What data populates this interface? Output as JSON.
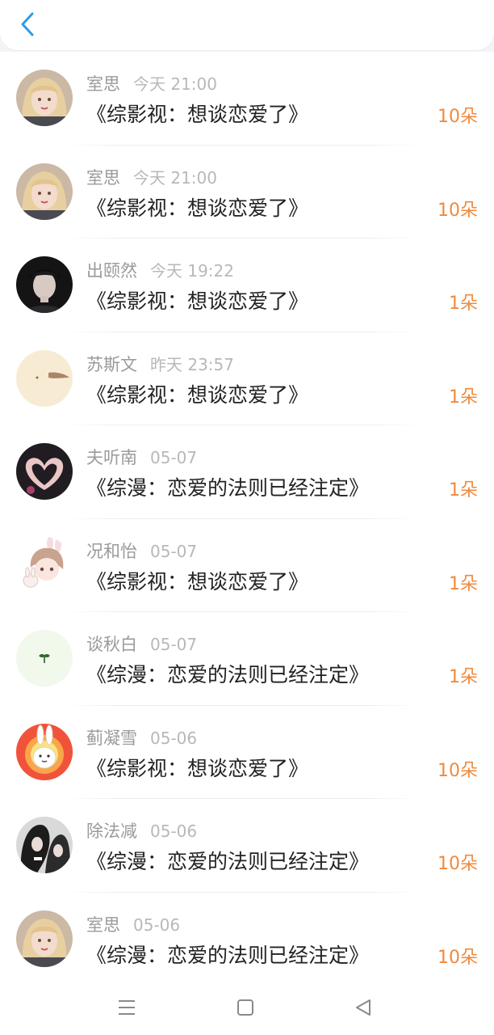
{
  "header": {
    "back_icon": "chevron-left-icon",
    "accent": "#2c9bea"
  },
  "colors": {
    "amount": "#ef8a3c",
    "name": "#9a9a9a",
    "time": "#b8b8b8",
    "title": "#222222"
  },
  "rows": [
    {
      "name": "室思",
      "time": "今天 21:00",
      "book": "《综影视：想谈恋爱了》",
      "amount": "10朵",
      "avatar": "avatar-blonde-girl"
    },
    {
      "name": "室思",
      "time": "今天 21:00",
      "book": "《综影视：想谈恋爱了》",
      "amount": "10朵",
      "avatar": "avatar-blonde-girl"
    },
    {
      "name": "出颐然",
      "time": "今天 19:22",
      "book": "《综影视：想谈恋爱了》",
      "amount": "1朵",
      "avatar": "avatar-dark-boy"
    },
    {
      "name": "苏斯文",
      "time": "昨天 23:57",
      "book": "《综影视：想谈恋爱了》",
      "amount": "1朵",
      "avatar": "avatar-beige"
    },
    {
      "name": "夫听南",
      "time": "05-07",
      "book": "《综漫：恋爱的法则已经注定》",
      "amount": "1朵",
      "avatar": "avatar-heart-hands"
    },
    {
      "name": "况和怡",
      "time": "05-07",
      "book": "《综影视：想谈恋爱了》",
      "amount": "1朵",
      "avatar": "avatar-anime-girl-bunny"
    },
    {
      "name": "谈秋白",
      "time": "05-07",
      "book": "《综漫：恋爱的法则已经注定》",
      "amount": "1朵",
      "avatar": "avatar-sprout"
    },
    {
      "name": "蓟凝雪",
      "time": "05-06",
      "book": "《综影视：想谈恋爱了》",
      "amount": "10朵",
      "avatar": "avatar-bunny-sun"
    },
    {
      "name": "除法减",
      "time": "05-06",
      "book": "《综漫：恋爱的法则已经注定》",
      "amount": "10朵",
      "avatar": "avatar-dark-anime"
    },
    {
      "name": "室思",
      "time": "05-06",
      "book": "《综漫：恋爱的法则已经注定》",
      "amount": "10朵",
      "avatar": "avatar-blonde-girl"
    }
  ],
  "navbar": {
    "menu_icon": "menu-icon",
    "home_icon": "square-home-icon",
    "back_icon": "triangle-back-icon"
  }
}
